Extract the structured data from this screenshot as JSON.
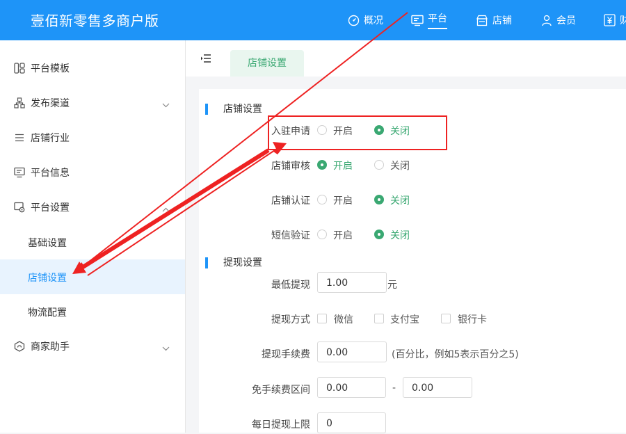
{
  "app": {
    "title": "壹佰新零售多商户版"
  },
  "topnav": [
    {
      "label": "概况",
      "icon": "dashboard-icon"
    },
    {
      "label": "平台",
      "icon": "monitor-icon",
      "active": true
    },
    {
      "label": "店铺",
      "icon": "store-icon"
    },
    {
      "label": "会员",
      "icon": "user-icon"
    },
    {
      "label": "财",
      "icon": "finance-icon"
    }
  ],
  "sidebar": {
    "items": [
      {
        "label": "平台模板",
        "icon": "template-icon"
      },
      {
        "label": "发布渠道",
        "icon": "channel-icon"
      },
      {
        "label": "店铺行业",
        "icon": "list-icon"
      },
      {
        "label": "平台信息",
        "icon": "info-icon"
      },
      {
        "label": "平台设置",
        "icon": "settings-icon"
      },
      {
        "label": "商家助手",
        "icon": "assistant-icon"
      }
    ],
    "subitems": [
      {
        "label": "基础设置"
      },
      {
        "label": "店铺设置",
        "active": true
      },
      {
        "label": "物流配置"
      }
    ]
  },
  "tabs": [
    {
      "label": "店铺设置"
    }
  ],
  "store_settings": {
    "title": "店铺设置",
    "rows": [
      {
        "label": "入驻申请",
        "options": [
          "开启",
          "关闭"
        ],
        "selected": "关闭"
      },
      {
        "label": "店铺审核",
        "options": [
          "开启",
          "关闭"
        ],
        "selected": "开启"
      },
      {
        "label": "店铺认证",
        "options": [
          "开启",
          "关闭"
        ],
        "selected": "关闭"
      },
      {
        "label": "短信验证",
        "options": [
          "开启",
          "关闭"
        ],
        "selected": "关闭"
      }
    ]
  },
  "withdraw_settings": {
    "title": "提现设置",
    "min_label": "最低提现",
    "min_value": "1.00",
    "min_unit": "元",
    "method_label": "提现方式",
    "methods": [
      "微信",
      "支付宝",
      "银行卡"
    ],
    "fee_label": "提现手续费",
    "fee_value": "0.00",
    "fee_note": "(百分比，例如5表示百分之5)",
    "free_label": "免手续费区间",
    "free_from": "0.00",
    "free_sep": "-",
    "free_to": "0.00",
    "daily_label": "每日提现上限",
    "daily_value": "0"
  },
  "colors": {
    "primary": "#1e94f8",
    "green": "#3aa872",
    "annotation": "#ee2222"
  }
}
